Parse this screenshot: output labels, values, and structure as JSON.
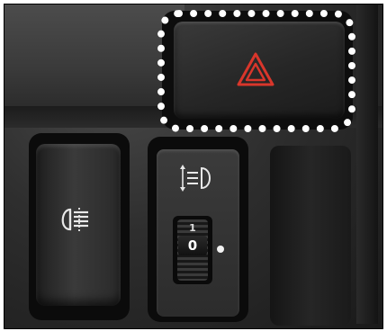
{
  "dial": {
    "tick_label": "1",
    "value_label": "0"
  },
  "icons": {
    "hazard": "hazard-warning-triangle-icon",
    "fog": "rear-fog-lamp-icon",
    "leveling": "headlamp-leveling-icon"
  },
  "colors": {
    "hazard_red": "#d9362b",
    "highlight": "#ffffff",
    "symbol_white": "#e8e8e8"
  }
}
